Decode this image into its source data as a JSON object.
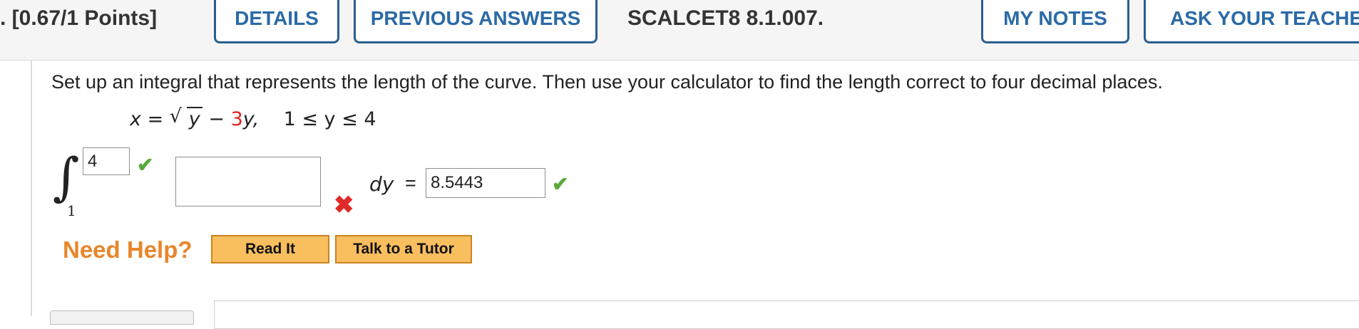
{
  "header": {
    "points": ". [0.67/1 Points]",
    "details_label": "DETAILS",
    "previous_answers_label": "PREVIOUS ANSWERS",
    "question_id": "SCALCET8 8.1.007.",
    "my_notes_label": "MY NOTES",
    "ask_teacher_label": "ASK YOUR TEACHER"
  },
  "question": {
    "prompt": "Set up an integral that represents the length of the curve. Then use your calculator to find the length correct to four decimal places.",
    "equation": {
      "lhs": "x",
      "equals": "=",
      "radicand": "y",
      "minus": "−",
      "coef": "3",
      "var": "y,",
      "range": "1 ≤ y ≤ 4"
    }
  },
  "answer": {
    "integral_symbol": "∫",
    "upper_limit": "4",
    "lower_limit": "1",
    "integrand": "",
    "dy_label": "dy",
    "equals": "=",
    "result": "8.5443",
    "correct_mark": "✔",
    "incorrect_mark": "✖"
  },
  "help": {
    "label": "Need Help?",
    "read_it": "Read It",
    "talk_to_tutor": "Talk to a Tutor"
  },
  "colors": {
    "accent_blue": "#2b6aa6",
    "correct_green": "#5aa83c",
    "wrong_red": "#e02a2a",
    "help_orange": "#e8862a",
    "button_orange": "#f9bf5f"
  }
}
